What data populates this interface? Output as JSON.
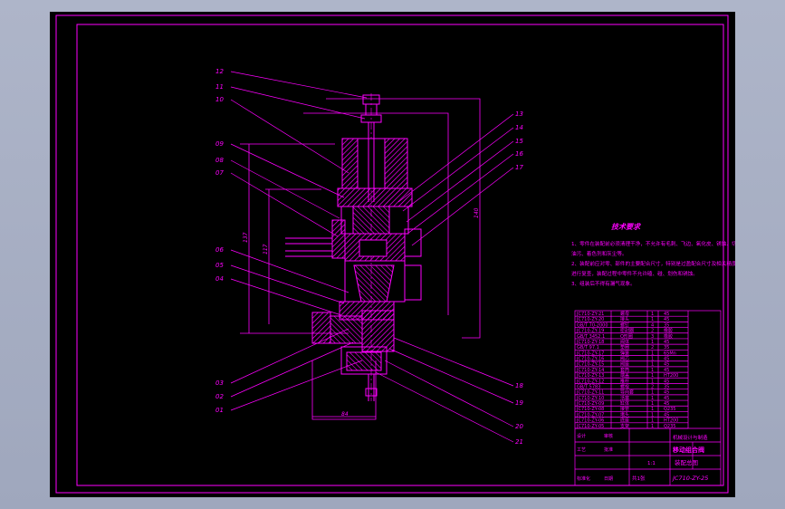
{
  "drawing": {
    "line_color": "#ff00ff",
    "background": "#000000",
    "outer_bg": "#a9b0c4",
    "part_numbers_left": [
      "12",
      "11",
      "10",
      "09",
      "08",
      "07",
      "06",
      "05",
      "04",
      "03",
      "02",
      "01"
    ],
    "part_numbers_right": [
      "13",
      "14",
      "15",
      "16",
      "17",
      "18",
      "19",
      "20",
      "21"
    ],
    "dimensions": {
      "height_left": "137",
      "height_mid": "117",
      "height_right": "140",
      "width_bottom": "84"
    },
    "technical_requirements": {
      "title": "技术要求",
      "lines": [
        "1、零件在装配前必须清理干净，不允许有毛刺、飞边、氧化皮、锈蚀、切屑、",
        "   油污、着色剂和灰尘等。",
        "2、装配前应对零、部件的主要配合尺寸，特别是过盈配合尺寸及相关精度",
        "   进行复查，装配过程中零件不允许磕、碰、划伤和锈蚀。",
        "3、组装后不得有漏气现象。"
      ]
    },
    "parts_list": [
      {
        "code": "JC710-ZY-21",
        "name": "螺母",
        "qty": "1",
        "material": "45"
      },
      {
        "code": "JC710-ZY-20",
        "name": "接头",
        "qty": "1",
        "material": "45"
      },
      {
        "code": "GB/T 70-2000",
        "name": "螺钉",
        "qty": "4",
        "material": "35"
      },
      {
        "code": "JC710-ZY-19",
        "name": "密封圈",
        "qty": "2",
        "material": "橡胶"
      },
      {
        "code": "GB/T 3452.1",
        "name": "O形圈",
        "qty": "3",
        "material": "橡胶"
      },
      {
        "code": "JC710-ZY-18",
        "name": "阀体",
        "qty": "1",
        "material": "45"
      },
      {
        "code": "GB/T 97.1",
        "name": "垫圈",
        "qty": "2",
        "material": "35"
      },
      {
        "code": "JC710-ZY-17",
        "name": "弹簧",
        "qty": "1",
        "material": "65Mn"
      },
      {
        "code": "JC710-ZY-16",
        "name": "阀芯",
        "qty": "1",
        "material": "45"
      },
      {
        "code": "JC710-ZY-15",
        "name": "阀座",
        "qty": "1",
        "material": "45"
      },
      {
        "code": "JC710-ZY-14",
        "name": "套筒",
        "qty": "1",
        "material": "45"
      },
      {
        "code": "JC710-ZY-13",
        "name": "端盖",
        "qty": "1",
        "material": "HT200"
      },
      {
        "code": "JC710-ZY-12",
        "name": "推杆",
        "qty": "1",
        "material": "45"
      },
      {
        "code": "GB/T 5783",
        "name": "螺栓",
        "qty": "2",
        "material": "35"
      },
      {
        "code": "JC710-ZY-11",
        "name": "导向套",
        "qty": "1",
        "material": "45"
      },
      {
        "code": "JC710-ZY-10",
        "name": "活塞",
        "qty": "1",
        "material": "45"
      },
      {
        "code": "JC710-ZY-09",
        "name": "缸体",
        "qty": "1",
        "material": "45"
      },
      {
        "code": "JC710-ZY-08",
        "name": "接管",
        "qty": "1",
        "material": "Q235"
      },
      {
        "code": "JC710-ZY-07",
        "name": "堵头",
        "qty": "1",
        "material": "45"
      },
      {
        "code": "JC710-ZY-06",
        "name": "底座",
        "qty": "1",
        "material": "HT200"
      },
      {
        "code": "JC710-ZY-05",
        "name": "支架",
        "qty": "1",
        "material": "Q235"
      }
    ],
    "title_block": {
      "drawing_name": "移动组合阀",
      "drawing_sub": "装配总图",
      "drawing_number": "JC710-ZY-25",
      "scale": "1:1",
      "sheet": "共1张",
      "company": "机械设计与制造",
      "labels": [
        "设计",
        "审核",
        "工艺",
        "批准",
        "标准化",
        "日期"
      ]
    }
  }
}
